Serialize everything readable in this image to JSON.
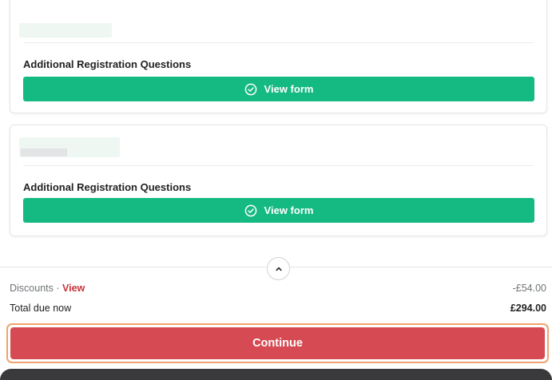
{
  "tickets": [
    {
      "question_label": "Additional Registration Questions",
      "view_form_label": "View form"
    },
    {
      "question_label": "Additional Registration Questions",
      "view_form_label": "View form"
    }
  ],
  "summary": {
    "discounts_label": "Discounts",
    "discounts_separator": " · ",
    "discounts_view_link": "View",
    "discounts_amount": "-£54.00",
    "total_label": "Total due now",
    "total_amount": "£294.00"
  },
  "actions": {
    "continue_label": "Continue"
  },
  "icons": {
    "view_form": "check-circle-icon",
    "collapse": "chevron-up-icon"
  },
  "colors": {
    "accent_green": "#15b982",
    "continue_red": "#d64b53",
    "link_red": "#c8323b",
    "focus_outline": "#f0a36e"
  }
}
